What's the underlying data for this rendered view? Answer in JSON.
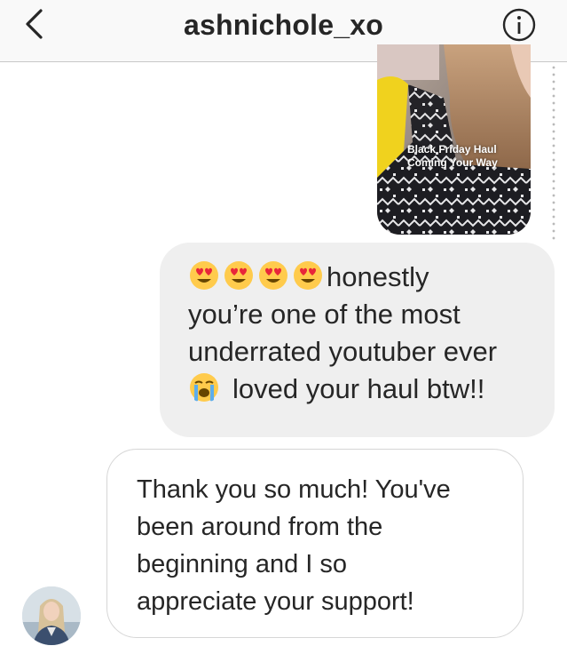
{
  "header": {
    "title": "ashnichole_xo",
    "back_icon": "chevron-left-icon",
    "info_icon": "info-icon"
  },
  "story": {
    "caption": "Black Friday Haul\nComing Your Way"
  },
  "messages": {
    "sent": {
      "lines": [
        "honestly",
        "you’re one of the most",
        "underrated youtuber ever",
        "loved your haul btw!!"
      ],
      "leading_emoji": "smiling-face-with-heart-eyes",
      "leading_emoji_count": 4,
      "inline_emoji": "loudly-crying-face"
    },
    "received": {
      "lines": [
        "Thank you so much! You've",
        "been around from the",
        "beginning and I so",
        "appreciate your support!"
      ]
    }
  },
  "colors": {
    "header_bg": "#f9f9f9",
    "sent_bubble": "#efefef",
    "text": "#262626",
    "border": "#d6d6d6"
  }
}
